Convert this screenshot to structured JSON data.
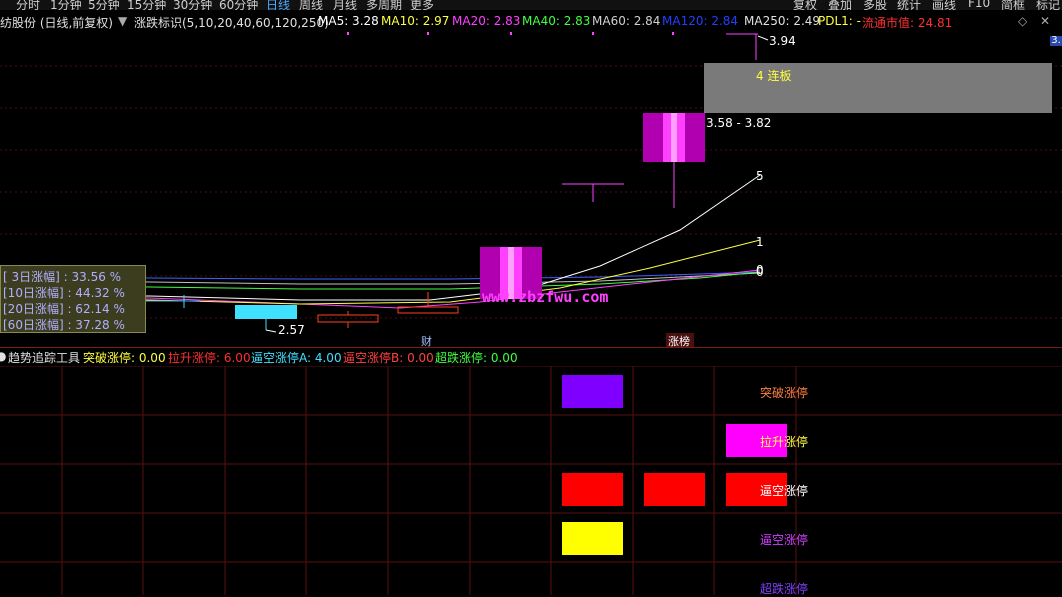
{
  "toolbar": {
    "periods": [
      "分时",
      "1分钟",
      "5分钟",
      "15分钟",
      "30分钟",
      "60分钟",
      "日线",
      "周线",
      "月线",
      "多周期",
      "更多"
    ],
    "active_period": "日线",
    "buttons": [
      "复权",
      "叠加",
      "多股",
      "统计",
      "画线",
      "F10",
      "简框",
      "标记"
    ]
  },
  "infobar": {
    "stock_title": "纺股份 (日线,前复权)",
    "indicator_name": "涨跌标识(5,10,20,40,60,120,250)",
    "ma": [
      {
        "label": "MA5: 3.28",
        "color": "#ffffff"
      },
      {
        "label": "MA10: 2.97",
        "color": "#ffff40"
      },
      {
        "label": "MA20: 2.83",
        "color": "#ff40ff"
      },
      {
        "label": "MA40: 2.83",
        "color": "#40ff40"
      },
      {
        "label": "MA60: 2.84",
        "color": "#d0d0d0"
      },
      {
        "label": "MA120: 2.84",
        "color": "#2040ff"
      },
      {
        "label": "MA250: 2.49",
        "color": "#e0e0e0"
      },
      {
        "label": "PDL1: -",
        "color": "#ffff40"
      },
      {
        "label": "流通市值: 24.81",
        "color": "#ff3030"
      }
    ],
    "right_icons": [
      "diamond-icon",
      "close-icon"
    ]
  },
  "chart_labels": {
    "high_price": "3.94",
    "limit_board": "4 连板",
    "range_label": "3.58 - 3.82",
    "low_price": "2.57",
    "line_label_5": "5",
    "line_label_1": "1",
    "line_label_0a": "0",
    "line_label_0b": "0",
    "event_cai": "财",
    "event_zhangbang": "涨榜",
    "watermark": "www.zbzfwu.com",
    "right_axis_price": "3."
  },
  "stats": [
    {
      "label": "[ 3日涨幅] : 33.56 %"
    },
    {
      "label": "[10日涨幅] : 44.32 %"
    },
    {
      "label": "[20日涨幅] : 62.14 %"
    },
    {
      "label": "[60日涨幅] : 37.28 %"
    }
  ],
  "indicator": {
    "name": "趋势追踪工具",
    "values": [
      {
        "label": "突破涨停: 0.00",
        "color": "#ffff40"
      },
      {
        "label": "拉升涨停: 6.00",
        "color": "#ff3030"
      },
      {
        "label": "逼空涨停A: 4.00",
        "color": "#40e0ff"
      },
      {
        "label": "逼空涨停B: 0.00",
        "color": "#ff4040"
      },
      {
        "label": "超跌涨停: 0.00",
        "color": "#40ff40"
      }
    ],
    "row_labels": [
      {
        "label": "突破涨停",
        "color": "#ff8040"
      },
      {
        "label": "拉升涨停",
        "color": "#ffff40"
      },
      {
        "label": "逼空涨停",
        "color": "#ffffff"
      },
      {
        "label": "逼空涨停",
        "color": "#d040ff"
      },
      {
        "label": "超跌涨停",
        "color": "#8040ff"
      }
    ]
  },
  "colors": {
    "purple_block": "#7f00ff",
    "magenta_block": "#ff00ff",
    "red_block": "#ff0000",
    "yellow_block": "#ffff00",
    "grid": "#5a0f0f"
  }
}
